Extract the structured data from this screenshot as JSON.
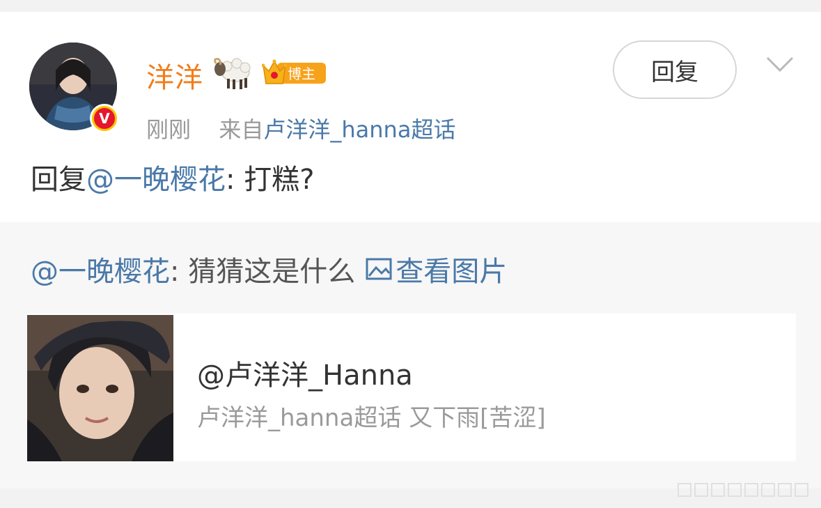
{
  "post": {
    "username": "洋洋",
    "badge_label": "博主",
    "time": "刚刚",
    "source_prefix": "来自",
    "source_link": "卢洋洋_hanna超话",
    "reply_button": "回复",
    "reply_prefix": "回复",
    "reply_mention": "@一晚樱花",
    "reply_body": ": 打糕?"
  },
  "quoted": {
    "mention": "@一晚樱花",
    "text": ": 猜猜这是什么",
    "view_image": "查看图片"
  },
  "share_card": {
    "title": "@卢洋洋_Hanna",
    "subtitle": "卢洋洋_hanna超话 又下雨[苦涩]"
  },
  "icons": [
    "sheep-emoji-icon",
    "crown-badge-icon",
    "verified-v-icon",
    "chevron-down-icon",
    "picture-icon"
  ],
  "colors": {
    "username": "#f17d1a",
    "link": "#4a79a8",
    "verified": "#e6162d",
    "badge": "#f7a21b"
  }
}
